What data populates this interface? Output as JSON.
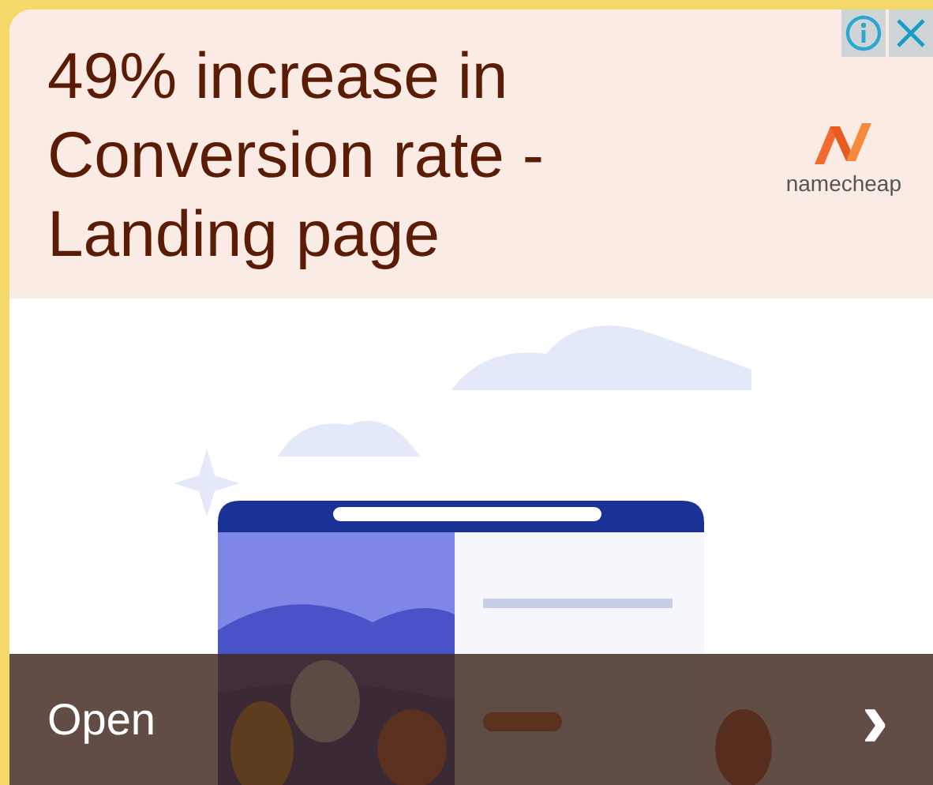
{
  "ad": {
    "headline": "49% increase in Conversion rate - Landing page",
    "brand": "namecheap",
    "cta": {
      "label": "Open",
      "arrow": "›"
    }
  }
}
